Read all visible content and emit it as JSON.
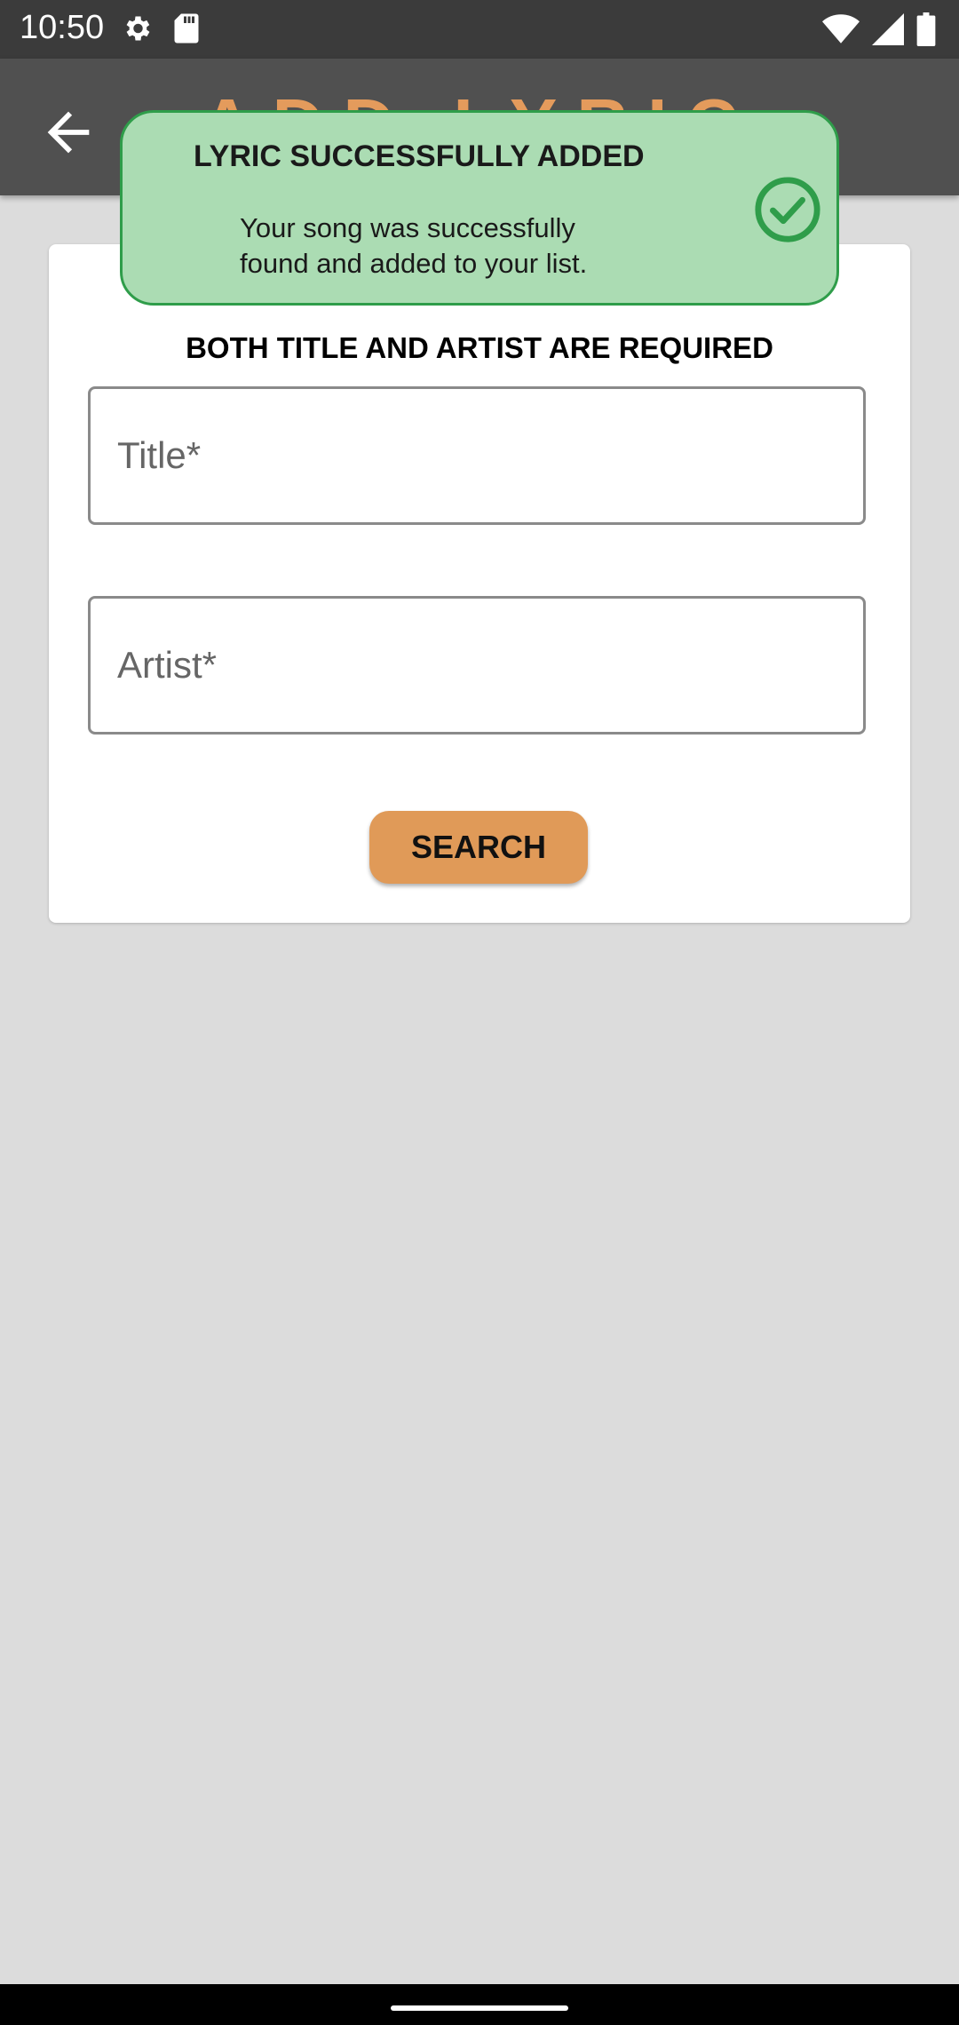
{
  "status_bar": {
    "time": "10:50",
    "icons_left": [
      "settings-icon",
      "sd-card-icon"
    ],
    "icons_right": [
      "wifi-icon",
      "signal-icon",
      "battery-icon"
    ]
  },
  "app_bar": {
    "title": "ADD LYRIC",
    "back_icon": "arrow-left-icon"
  },
  "toast": {
    "title": "LYRIC SUCCESSFULLY ADDED",
    "message_line1": "Your song was successfully",
    "message_line2": "found and added to your list.",
    "icon": "check-circle-icon"
  },
  "form": {
    "requirement_text": "BOTH TITLE AND ARTIST ARE REQUIRED",
    "title_placeholder": "Title*",
    "title_value": "",
    "artist_placeholder": "Artist*",
    "artist_value": "",
    "search_label": "SEARCH"
  },
  "colors": {
    "accent": "#e09a58",
    "toast_background": "#abdcb3",
    "toast_border": "#2f9d4a",
    "app_bar": "#505050",
    "background": "#dcdcdc"
  }
}
